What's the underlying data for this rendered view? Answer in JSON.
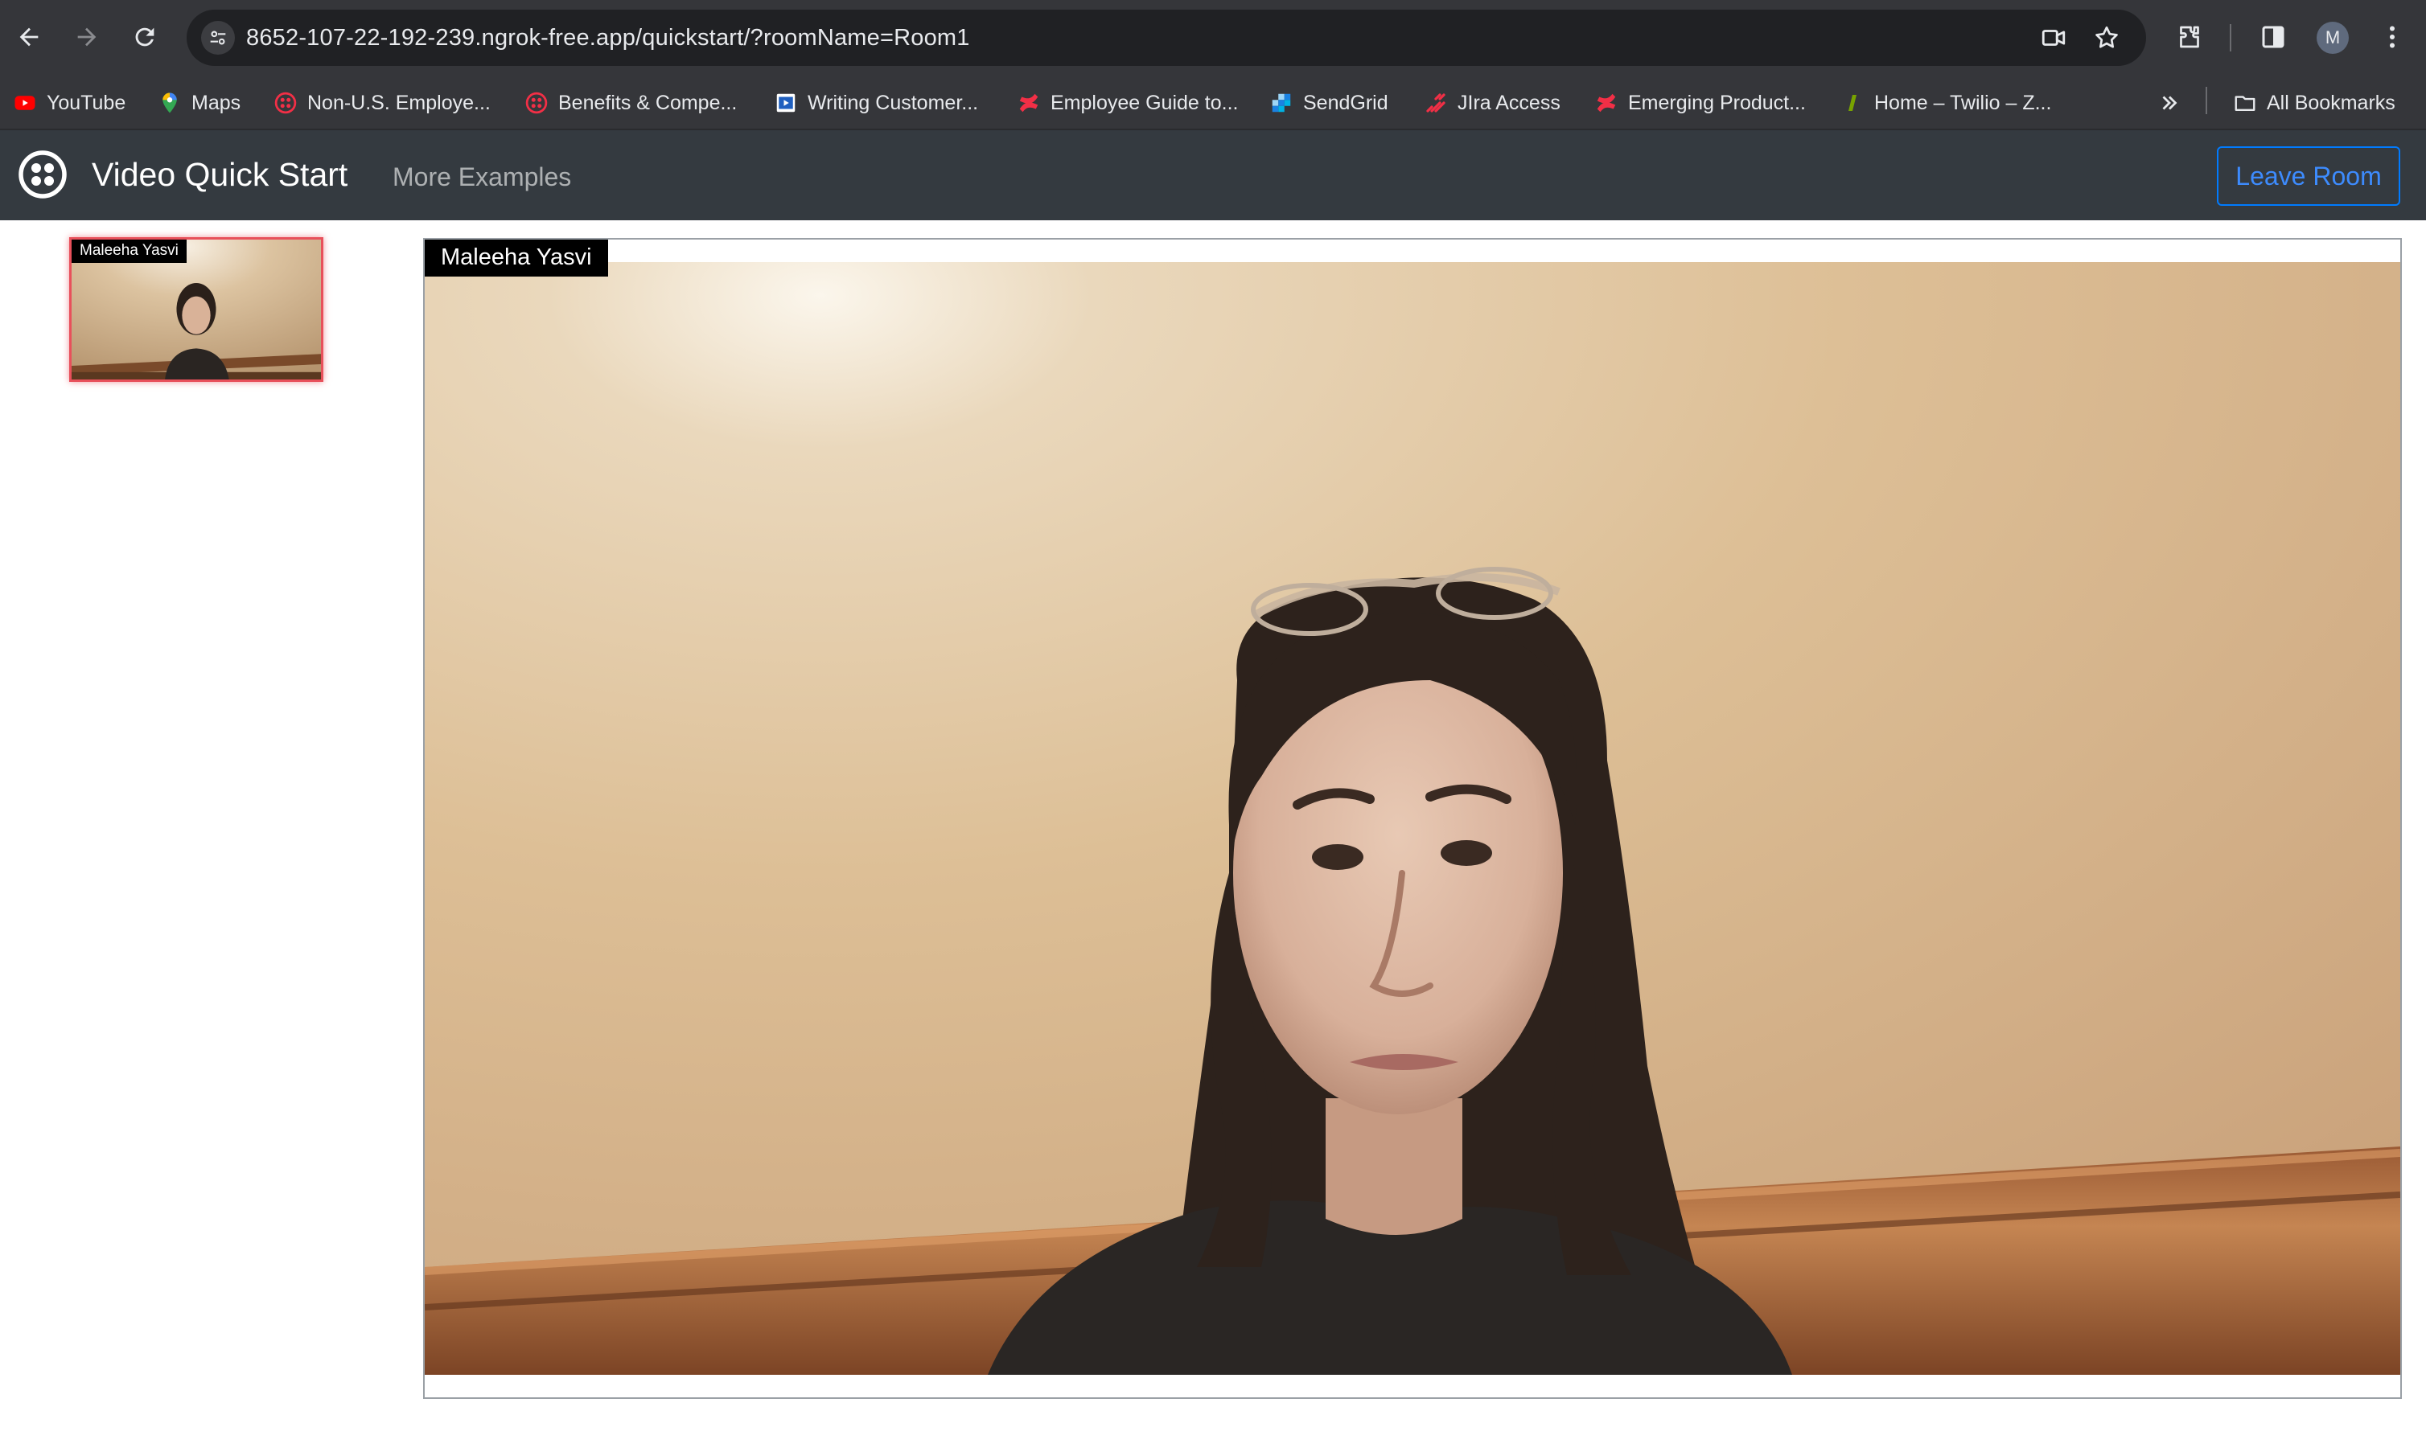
{
  "browser": {
    "url": "8652-107-22-192-239.ngrok-free.app/quickstart/?roomName=Room1",
    "avatar_letter": "M",
    "bookmarks": [
      {
        "label": "YouTube",
        "icon": "youtube-icon",
        "color": "#ff0000"
      },
      {
        "label": "Maps",
        "icon": "maps-pin-icon",
        "color": "#34a853"
      },
      {
        "label": "Non-U.S. Employe...",
        "icon": "twilio-logo-icon",
        "color": "#f22f46"
      },
      {
        "label": "Benefits & Compe...",
        "icon": "twilio-logo-icon",
        "color": "#f22f46"
      },
      {
        "label": "Writing Customer...",
        "icon": "video-doc-icon",
        "color": "#4285f4"
      },
      {
        "label": "Employee Guide to...",
        "icon": "confluence-icon",
        "color": "#f22f46"
      },
      {
        "label": "SendGrid",
        "icon": "sendgrid-icon",
        "color": "#1a82e2"
      },
      {
        "label": "JIra Access",
        "icon": "jira-icon",
        "color": "#f22f46"
      },
      {
        "label": "Emerging Product...",
        "icon": "confluence-icon",
        "color": "#f22f46"
      },
      {
        "label": "Home – Twilio – Z...",
        "icon": "zendesk-icon",
        "color": "#78a300"
      }
    ],
    "all_bookmarks_label": "All Bookmarks"
  },
  "app": {
    "brand": "Video Quick Start",
    "nav_link": "More Examples",
    "leave_button": "Leave Room",
    "accent_color": "#007bff"
  },
  "participants": {
    "local_thumbnail_name": "Maleeha Yasvi",
    "active_speaker_name": "Maleeha Yasvi"
  }
}
